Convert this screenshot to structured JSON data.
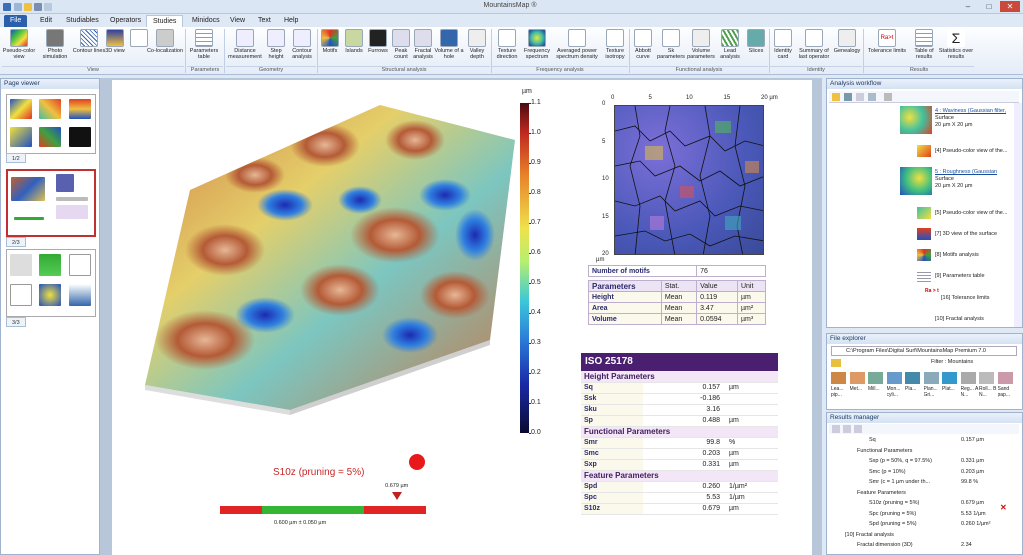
{
  "app": {
    "title": "MountainsMap ®"
  },
  "menu": [
    "File",
    "Edit",
    "Studiables",
    "Operators",
    "Studies",
    "Minidocs",
    "View",
    "Text",
    "Help"
  ],
  "ribbon": {
    "groups": [
      {
        "label": "View",
        "buttons": [
          "Pseudo-color view",
          "Photo simulation",
          "Contour lines",
          "3D view",
          "",
          "Co-localization"
        ]
      },
      {
        "label": "Parameters",
        "buttons": [
          "Parameters table"
        ]
      },
      {
        "label": "Geometry",
        "buttons": [
          "Distance measurement",
          "Step height",
          "Contour analysis"
        ]
      },
      {
        "label": "Structural analysis",
        "buttons": [
          "Motifs",
          "Islands",
          "Furrows",
          "Peak count",
          "Fractal analysis",
          "Volume of a hole",
          "Valley depth"
        ]
      },
      {
        "label": "Frequency analysis",
        "buttons": [
          "Texture direction",
          "Frequency spectrum",
          "Averaged power spectrum density",
          "Texture isotropy"
        ]
      },
      {
        "label": "Functional analysis",
        "buttons": [
          "Abbott curve",
          "Sk parameters",
          "Volume parameters",
          "Lead analysis",
          "Slices"
        ]
      },
      {
        "label": "Identity",
        "buttons": [
          "Identity card",
          "Summary of last operator",
          "Genealogy"
        ]
      },
      {
        "label": "Results",
        "buttons": [
          "Tolerance limits",
          "Table of results",
          "Statistics over results"
        ]
      }
    ]
  },
  "page_viewer": {
    "title": "Page viewer",
    "pages": [
      "1/2",
      "2/3",
      "3/3"
    ]
  },
  "colorbar": {
    "unit": "µm",
    "ticks": [
      "1.1",
      "1.0",
      "0.9",
      "0.8",
      "0.7",
      "0.6",
      "0.5",
      "0.4",
      "0.3",
      "0.2",
      "0.1",
      "0.0"
    ]
  },
  "motif_map": {
    "x_ticks": [
      "0",
      "5",
      "10",
      "15",
      "20 µm"
    ],
    "y_ticks": [
      "0",
      "5",
      "10",
      "15",
      "20"
    ],
    "unit": "µm"
  },
  "motifs_table": {
    "count_label": "Number of motifs",
    "count": "76",
    "headers": [
      "Parameters",
      "Stat.",
      "Value",
      "Unit"
    ],
    "rows": [
      [
        "Height",
        "Mean",
        "0.119",
        "µm"
      ],
      [
        "Area",
        "Mean",
        "3.47",
        "µm²"
      ],
      [
        "Volume",
        "Mean",
        "0.0594",
        "µm³"
      ]
    ]
  },
  "iso": {
    "title": "ISO 25178",
    "sections": [
      {
        "name": "Height Parameters",
        "rows": [
          [
            "Sq",
            "0.157",
            "µm"
          ],
          [
            "Ssk",
            "-0.186",
            ""
          ],
          [
            "Sku",
            "3.16",
            ""
          ],
          [
            "Sp",
            "0.488",
            "µm"
          ]
        ]
      },
      {
        "name": "Functional Parameters",
        "rows": [
          [
            "Smr",
            "99.8",
            "%"
          ],
          [
            "Smc",
            "0.203",
            "µm"
          ],
          [
            "Sxp",
            "0.331",
            "µm"
          ]
        ]
      },
      {
        "name": "Feature Parameters",
        "rows": [
          [
            "Spd",
            "0.260",
            "1/µm²"
          ],
          [
            "Spc",
            "5.53",
            "1/µm"
          ],
          [
            "S10z",
            "0.679",
            "µm"
          ]
        ]
      }
    ]
  },
  "tolerance": {
    "label": "S10z (pruning = 5%)",
    "marker_value": "0.679 µm",
    "range": "0.600 µm ± 0.050 µm",
    "status_color": "#e8191a",
    "marker_fraction": 0.86
  },
  "workflow": {
    "title": "Analysis workflow",
    "items": [
      {
        "link": "4 : Waviness (Gaussian filter,",
        "sub": "Surface",
        "dim": "20 µm X 20 µm"
      },
      {
        "text": "[4] Pseudo-color view of the..."
      },
      {
        "link": "5 : Roughness (Gaussian",
        "sub": "Surface",
        "dim": "20 µm X 20 µm"
      },
      {
        "text": "[5] Pseudo-color view of the..."
      },
      {
        "text": "[7] 3D view of the surface"
      },
      {
        "text": "[8] Motifs analysis"
      },
      {
        "text": "[9] Parameters table"
      },
      {
        "text": "[16] Tolerance limits"
      },
      {
        "text": "[10] Fractal analysis"
      }
    ],
    "badge": "Ra > t"
  },
  "file_explorer": {
    "title": "File explorer",
    "path": "C:\\Program Files\\Digital Surf\\MountainsMap Premium 7.0",
    "filter": "Filter : Mountains",
    "files": [
      "Lea... pip...",
      "Met...",
      "Mill...",
      "Mon... cyli...",
      "Pla...",
      "Plan... Gri...",
      "Plat...",
      "Reg... A N...",
      "Roll... B N...",
      "Sand pap..."
    ]
  },
  "results_manager": {
    "title": "Results manager",
    "rows": [
      {
        "name": "Sq",
        "val": "0.157 µm",
        "lvl": 3
      },
      {
        "name": "Functional Parameters",
        "val": "",
        "lvl": 2
      },
      {
        "name": "Sxp (p = 50%, q = 97.5%)",
        "val": "0.331 µm",
        "lvl": 3
      },
      {
        "name": "Smc (p = 10%)",
        "val": "0.203 µm",
        "lvl": 3
      },
      {
        "name": "Smr (c = 1 µm under th...",
        "val": "99.8 %",
        "lvl": 3
      },
      {
        "name": "Feature Parameters",
        "val": "",
        "lvl": 2
      },
      {
        "name": "S10z (pruning = 5%)",
        "val": "0.679 µm",
        "lvl": 3
      },
      {
        "name": "Spc (pruning = 5%)",
        "val": "5.53 1/µm",
        "lvl": 3
      },
      {
        "name": "Spd (pruning = 5%)",
        "val": "0.260 1/µm²",
        "lvl": 3
      },
      {
        "name": "[10] Fractal analysis",
        "val": "",
        "lvl": 1
      },
      {
        "name": "Fractal dimension (3D)",
        "val": "2.34",
        "lvl": 2
      }
    ]
  }
}
